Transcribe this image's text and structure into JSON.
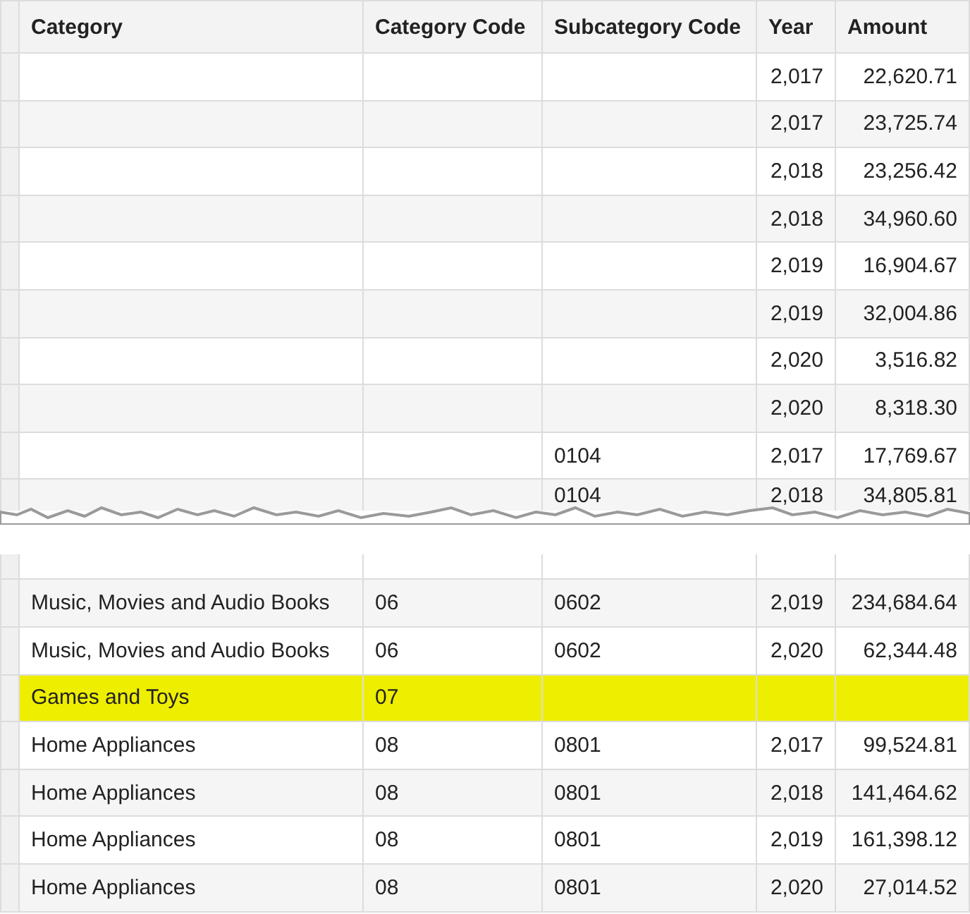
{
  "table": {
    "columns": [
      "Category",
      "Category Code",
      "Subcategory Code",
      "Year",
      "Amount"
    ],
    "top_rows": [
      {
        "cells": [
          "",
          "",
          "",
          "2,017",
          "22,620.71"
        ],
        "highlighted": false
      },
      {
        "cells": [
          "",
          "",
          "",
          "2,017",
          "23,725.74"
        ],
        "highlighted": false
      },
      {
        "cells": [
          "",
          "",
          "",
          "2,018",
          "23,256.42"
        ],
        "highlighted": false
      },
      {
        "cells": [
          "",
          "",
          "",
          "2,018",
          "34,960.60"
        ],
        "highlighted": false
      },
      {
        "cells": [
          "",
          "",
          "",
          "2,019",
          "16,904.67"
        ],
        "highlighted": false
      },
      {
        "cells": [
          "",
          "",
          "",
          "2,019",
          "32,004.86"
        ],
        "highlighted": false
      },
      {
        "cells": [
          "",
          "",
          "",
          "2,020",
          "3,516.82"
        ],
        "highlighted": false
      },
      {
        "cells": [
          "",
          "",
          "",
          "2,020",
          "8,318.30"
        ],
        "highlighted": false
      },
      {
        "cells": [
          "",
          "",
          "0104",
          "2,017",
          "17,769.67"
        ],
        "highlighted": false
      },
      {
        "cells": [
          "",
          "",
          "0104",
          "2,018",
          "34,805.81"
        ],
        "highlighted": false
      }
    ],
    "bottom_rows": [
      {
        "cells": [
          "Music, Movies and Audio Books",
          "06",
          "0602",
          "2,019",
          "234,684.64"
        ],
        "highlighted": false
      },
      {
        "cells": [
          "Music, Movies and Audio Books",
          "06",
          "0602",
          "2,020",
          "62,344.48"
        ],
        "highlighted": false
      },
      {
        "cells": [
          "Games and Toys",
          "07",
          "",
          "",
          ""
        ],
        "highlighted": true
      },
      {
        "cells": [
          "Home Appliances",
          "08",
          "0801",
          "2,017",
          "99,524.81"
        ],
        "highlighted": false
      },
      {
        "cells": [
          "Home Appliances",
          "08",
          "0801",
          "2,018",
          "141,464.62"
        ],
        "highlighted": false
      },
      {
        "cells": [
          "Home Appliances",
          "08",
          "0801",
          "2,019",
          "161,398.12"
        ],
        "highlighted": false
      },
      {
        "cells": [
          "Home Appliances",
          "08",
          "0801",
          "2,020",
          "27,014.52"
        ],
        "highlighted": false
      }
    ]
  }
}
